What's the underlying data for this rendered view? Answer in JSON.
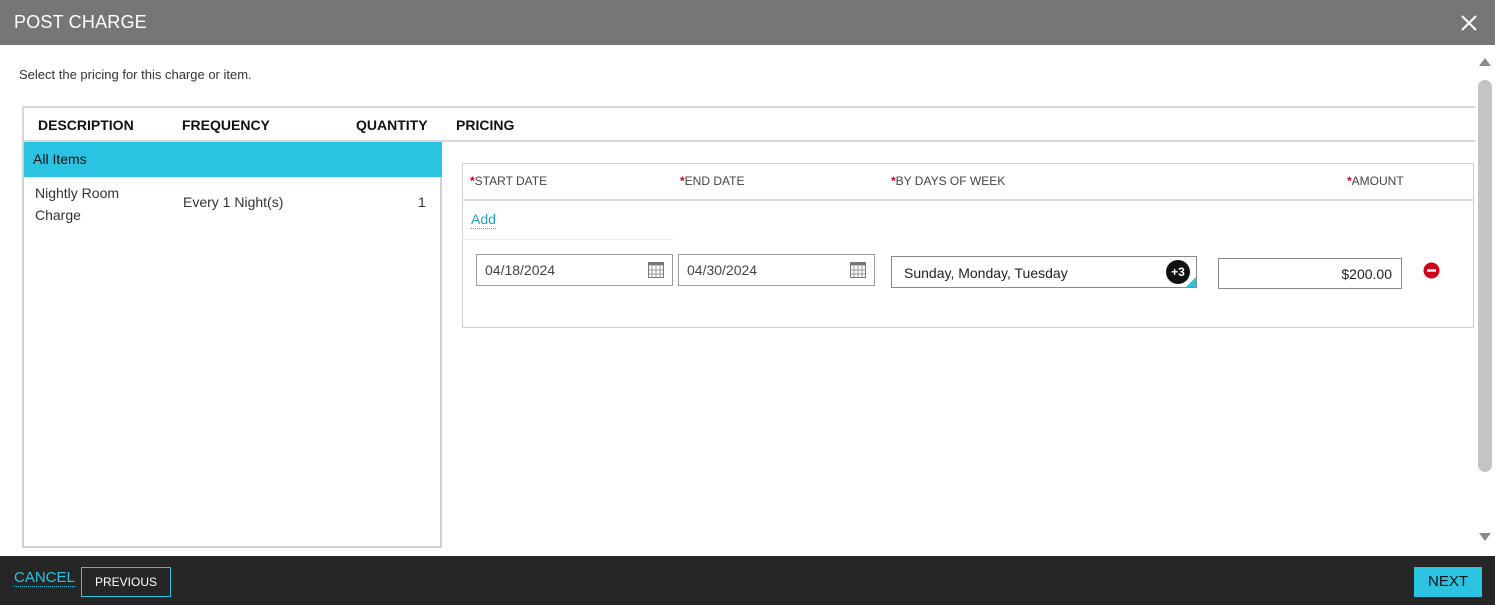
{
  "dialog": {
    "title": "POST CHARGE",
    "instructions": "Select the pricing for this charge or item."
  },
  "grid": {
    "headers": [
      "DESCRIPTION",
      "FREQUENCY",
      "QUANTITY",
      "PRICING"
    ],
    "all_items_label": "All Items",
    "items": [
      {
        "description": "Nightly Room Charge",
        "frequency": "Every 1 Night(s)",
        "quantity": "1"
      }
    ]
  },
  "pricing": {
    "columns": {
      "start_date": "START DATE",
      "end_date": "END DATE",
      "days_of_week": "BY DAYS OF WEEK",
      "amount": "AMOUNT"
    },
    "required_marker": "*",
    "add_label": "Add",
    "rows": [
      {
        "start_date": "04/18/2024",
        "end_date": "04/30/2024",
        "days": "Sunday, Monday, Tuesday",
        "more_days_badge": "+3",
        "amount": "$200.00"
      }
    ]
  },
  "footer": {
    "cancel_label": "CANCEL",
    "previous_label": "PREVIOUS",
    "next_label": "NEXT"
  },
  "colors": {
    "accent": "#2ac3e2",
    "titlebar": "#767676",
    "footer": "#262626",
    "required": "#d0021b",
    "remove": "#d0021b"
  },
  "icons": {
    "close": "close-icon",
    "calendar": "calendar-icon",
    "remove": "minus-circle-icon"
  }
}
